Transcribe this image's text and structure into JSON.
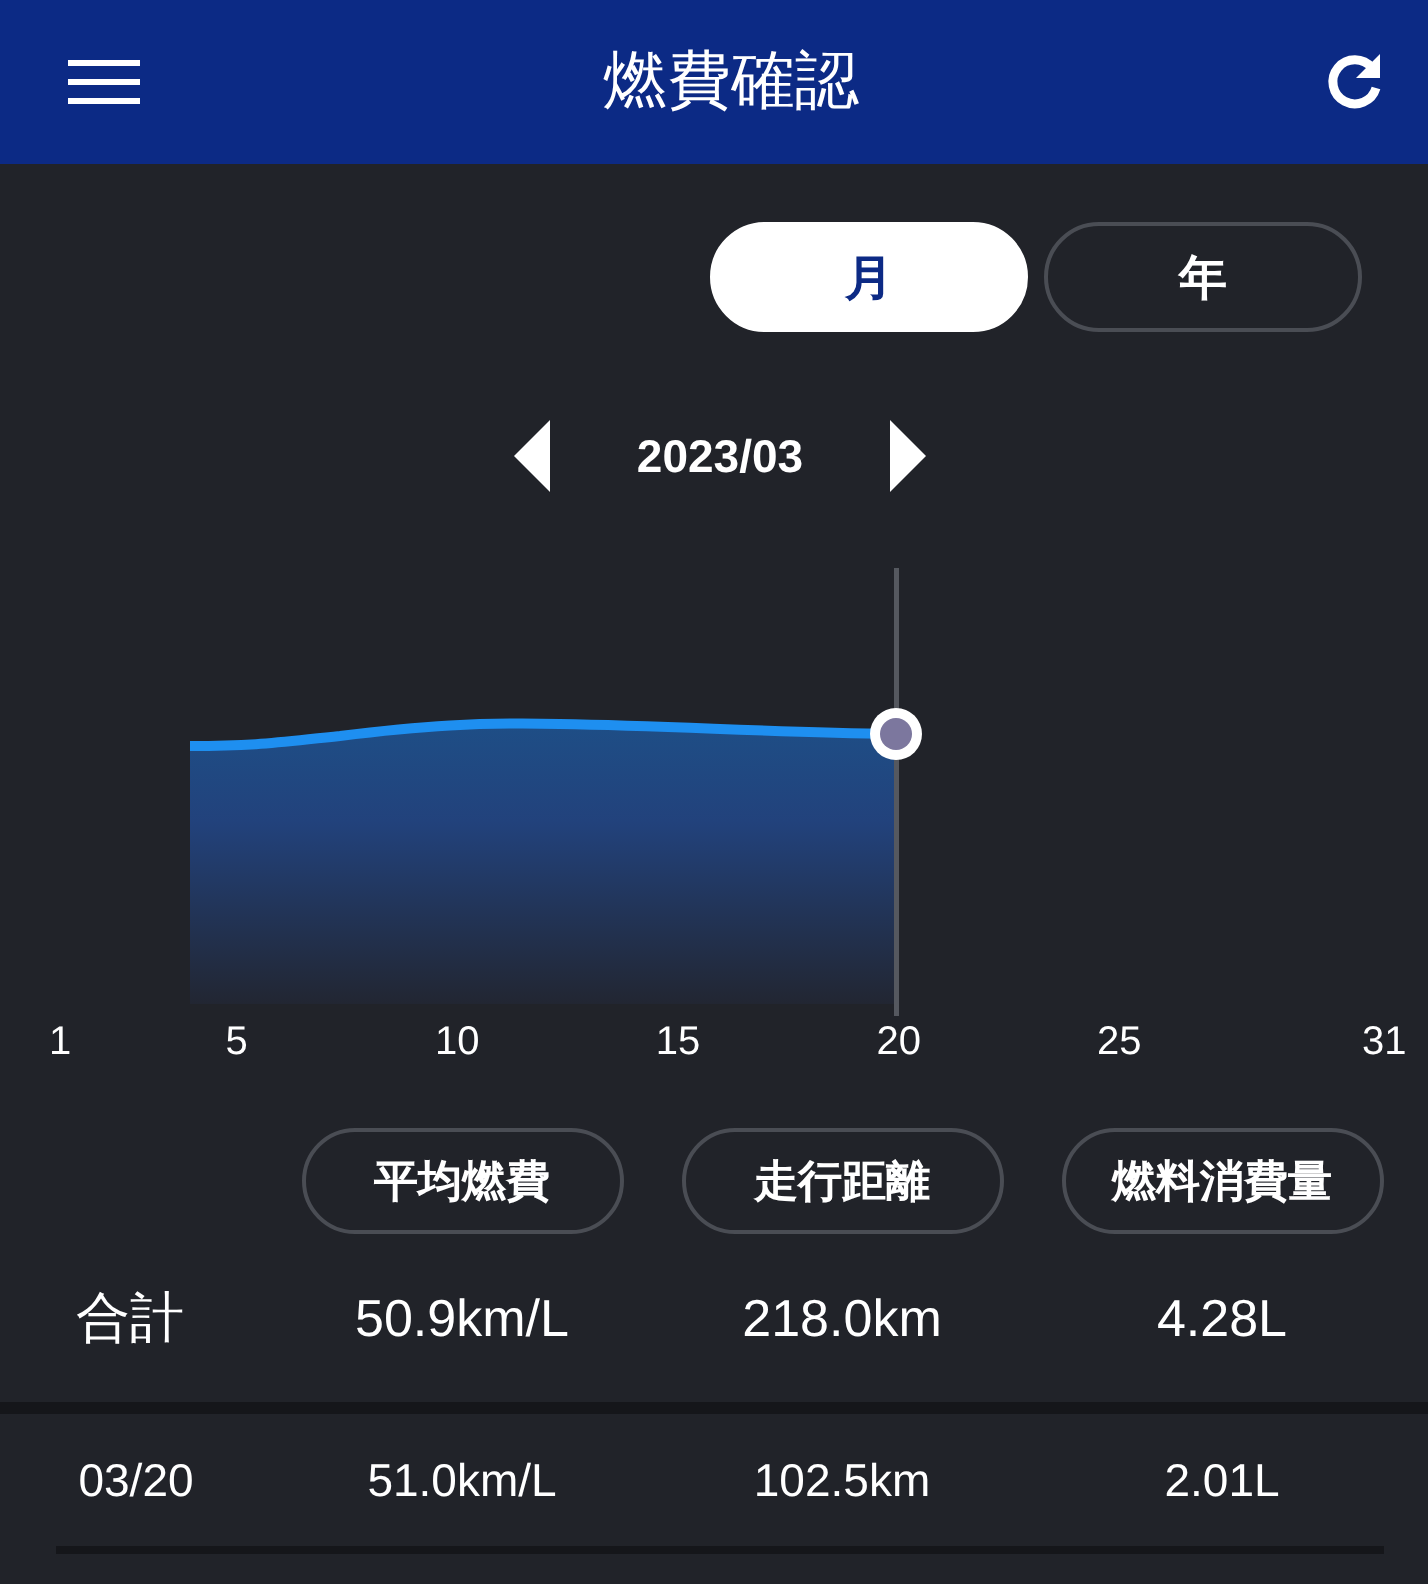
{
  "header": {
    "title": "燃費確認"
  },
  "period_tabs": [
    {
      "label": "月",
      "selected": true
    },
    {
      "label": "年",
      "selected": false
    }
  ],
  "period": {
    "label": "2023/03"
  },
  "chart": {
    "x_ticks": [
      "1",
      "5",
      "10",
      "15",
      "20",
      "25",
      "31"
    ]
  },
  "table": {
    "columns": [
      "平均燃費",
      "走行距離",
      "燃料消費量"
    ],
    "total": {
      "label": "合計",
      "values": [
        "50.9km/L",
        "218.0km",
        "4.28L"
      ]
    },
    "rows": [
      {
        "date": "03/20",
        "values": [
          "51.0km/L",
          "102.5km",
          "2.01L"
        ]
      }
    ]
  }
}
